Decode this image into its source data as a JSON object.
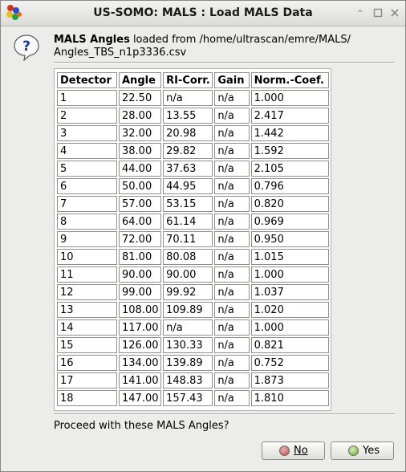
{
  "window": {
    "title": "US-SOMO: MALS : Load MALS Data",
    "icons": {
      "app": "us-somo-app-icon",
      "shade": "shade-icon",
      "maximize": "maximize-icon",
      "close": "close-icon"
    }
  },
  "dialog": {
    "icon": "question-icon",
    "heading_bold": "MALS Angles",
    "heading_rest": " loaded from /home/ultrascan/emre/MALS/",
    "heading_line2": "Angles_TBS_n1p3336.csv",
    "columns": [
      "Detector",
      "Angle",
      "RI-Corr.",
      "Gain",
      "Norm.-Coef."
    ],
    "rows": [
      [
        "1",
        "22.50",
        "n/a",
        "n/a",
        "1.000"
      ],
      [
        "2",
        "28.00",
        "13.55",
        "n/a",
        "2.417"
      ],
      [
        "3",
        "32.00",
        "20.98",
        "n/a",
        "1.442"
      ],
      [
        "4",
        "38.00",
        "29.82",
        "n/a",
        "1.592"
      ],
      [
        "5",
        "44.00",
        "37.63",
        "n/a",
        "2.105"
      ],
      [
        "6",
        "50.00",
        "44.95",
        "n/a",
        "0.796"
      ],
      [
        "7",
        "57.00",
        "53.15",
        "n/a",
        "0.820"
      ],
      [
        "8",
        "64.00",
        "61.14",
        "n/a",
        "0.969"
      ],
      [
        "9",
        "72.00",
        "70.11",
        "n/a",
        "0.950"
      ],
      [
        "10",
        "81.00",
        "80.08",
        "n/a",
        "1.015"
      ],
      [
        "11",
        "90.00",
        "90.00",
        "n/a",
        "1.000"
      ],
      [
        "12",
        "99.00",
        "99.92",
        "n/a",
        "1.037"
      ],
      [
        "13",
        "108.00",
        "109.89",
        "n/a",
        "1.020"
      ],
      [
        "14",
        "117.00",
        "n/a",
        "n/a",
        "1.000"
      ],
      [
        "15",
        "126.00",
        "130.33",
        "n/a",
        "0.821"
      ],
      [
        "16",
        "134.00",
        "139.89",
        "n/a",
        "0.752"
      ],
      [
        "17",
        "141.00",
        "148.83",
        "n/a",
        "1.873"
      ],
      [
        "18",
        "147.00",
        "157.43",
        "n/a",
        "1.810"
      ]
    ],
    "prompt": "Proceed with these MALS Angles?",
    "buttons": {
      "no": {
        "label": "No",
        "icon": "red-dot-icon",
        "color": "#b84a4a"
      },
      "yes": {
        "label": "Yes",
        "icon": "green-dot-icon",
        "color": "#6aa83a"
      }
    }
  }
}
